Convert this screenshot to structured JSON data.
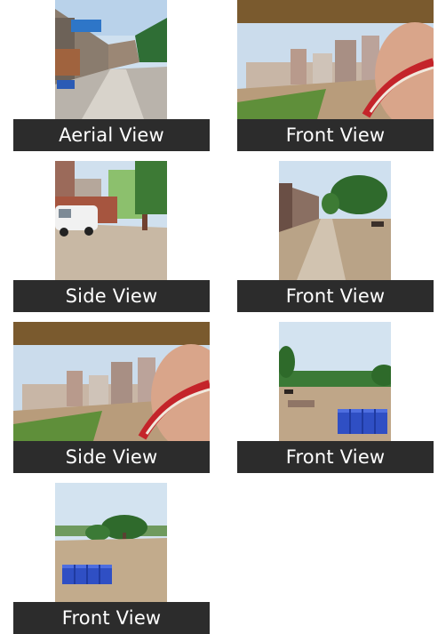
{
  "captions": {
    "c1": "Aerial View",
    "c2": "Front View",
    "c3": "Side View",
    "c4": "Front View",
    "c5": "Side View",
    "c6": "Front View",
    "c7": "Front View"
  },
  "colors": {
    "caption_bg": "#2c2c2c",
    "caption_text": "#ffffff",
    "header_band": "#7a5a2e",
    "sky": "#c9dbeb",
    "dirt": "#b59a78",
    "crates": "#2f4fc4"
  }
}
